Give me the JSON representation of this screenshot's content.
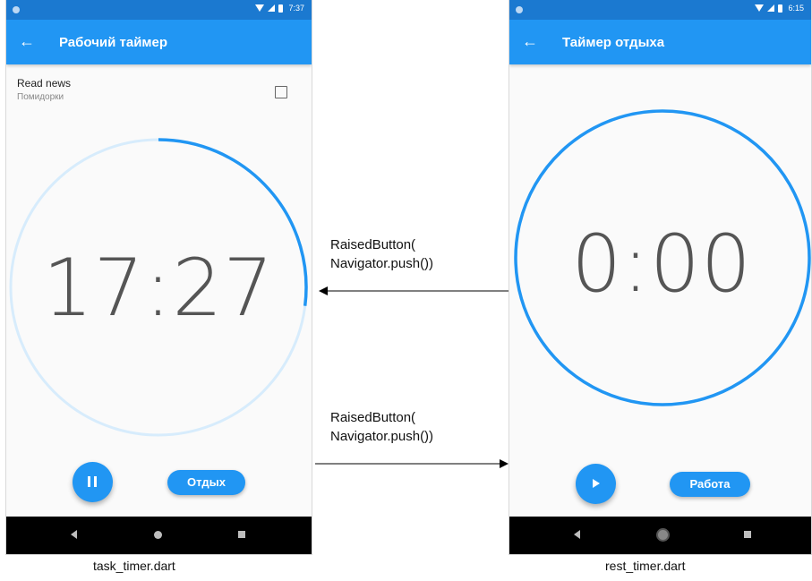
{
  "task_screen": {
    "status_time": "7:37",
    "app_title": "Рабочий таймер",
    "task_name": "Read news",
    "task_project": "Помидорки",
    "timer": "17:27",
    "progress_fraction": 0.27,
    "rest_button_label": "Отдых",
    "play_icon": "pause-icon",
    "caption": "task_timer.dart"
  },
  "rest_screen": {
    "status_time": "6:15",
    "app_title": "Таймер отдыха",
    "timer": "0:00",
    "progress_fraction": 1.0,
    "work_button_label": "Работа",
    "play_icon": "play-icon",
    "caption": "rest_timer.dart"
  },
  "arrows": {
    "top_label_line1": "RaisedButton(",
    "top_label_line2": "Navigator.push())",
    "bottom_label_line1": "RaisedButton(",
    "bottom_label_line2": "Navigator.push())"
  },
  "colors": {
    "primary": "#2196f3",
    "status_bar": "#1b79d0",
    "track": "#d7ecfc"
  }
}
